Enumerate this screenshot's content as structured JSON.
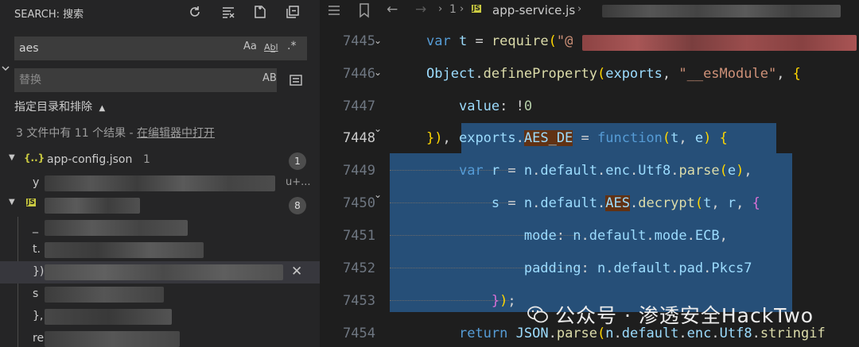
{
  "sidebar": {
    "title": "SEARCH: 搜索",
    "search": {
      "value": "aes",
      "opt_case": "Aa",
      "opt_word": "Ab̲l",
      "opt_regex": ".*"
    },
    "replace": {
      "placeholder": "替换",
      "opt_preserve": "AB"
    },
    "include_toggle": "指定目录和排除",
    "summary_prefix": "3 文件中有 11 个结果 - ",
    "summary_link": "在编辑器中打开",
    "files": [
      {
        "name": "app-config.json",
        "count": "1",
        "icon": "{..}"
      },
      {
        "name": "",
        "count": "8",
        "icon": "JS"
      }
    ],
    "result_prefixes": [
      "y",
      "_",
      "t.",
      "})",
      "s",
      "},",
      "re"
    ],
    "result_suffix": "u+..."
  },
  "editor": {
    "breadcrumb_num": "1",
    "breadcrumb_file": "app-service.js",
    "breadcrumb_icon": "JS",
    "line_numbers": [
      "7445",
      "7446",
      "7447",
      "7448",
      "7449",
      "7450",
      "7451",
      "7452",
      "7453",
      "7454"
    ],
    "current_line": "7448"
  },
  "watermark": "公众号 · 渗透安全HackTwo",
  "colors": {
    "selection": "#264f78",
    "highlight": "#613214",
    "accent_js": "#cbcb41"
  }
}
